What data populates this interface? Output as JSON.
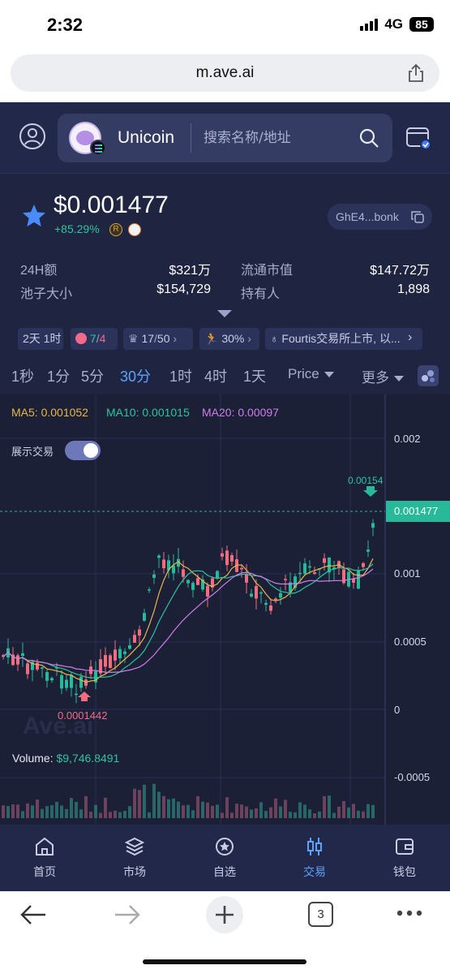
{
  "status": {
    "time": "2:32",
    "network": "4G",
    "battery": "85"
  },
  "browser": {
    "url": "m.ave.ai",
    "tab_count": "3"
  },
  "header": {
    "token_name": "Unicoin",
    "search_placeholder": "搜索名称/地址"
  },
  "price": {
    "value": "$0.001477",
    "change": "+85.29%",
    "address": "GhE4...bonk",
    "stats": [
      {
        "label": "24H额",
        "value": "$321万"
      },
      {
        "label": "流通市值",
        "value": "$147.72万"
      },
      {
        "label": "池子大小",
        "value": "$154,729"
      },
      {
        "label": "持有人",
        "value": "1,898"
      }
    ]
  },
  "chips": {
    "age": "2天 1时",
    "bag_a": "7",
    "bag_b": "4",
    "crown_a": "17",
    "crown_b": "50",
    "runner": "30%",
    "news": "Fourtis交易所上市, 以..."
  },
  "timeframes": [
    {
      "label": "1秒",
      "active": false
    },
    {
      "label": "1分",
      "active": false
    },
    {
      "label": "5分",
      "active": false
    },
    {
      "label": "30分",
      "active": true
    },
    {
      "label": "1时",
      "active": false
    },
    {
      "label": "4时",
      "active": false
    },
    {
      "label": "1天",
      "active": false
    }
  ],
  "dropdowns": {
    "price_mode": "Price",
    "more": "更多"
  },
  "chart": {
    "ma5": "MA5: 0.001052",
    "ma10": "MA10: 0.001015",
    "ma20": "MA20: 0.00097",
    "show_trades": "展示交易",
    "y_ticks": [
      "0.002",
      "0.001",
      "0.0005",
      "0",
      "-0.0005"
    ],
    "last_price": "0.001477",
    "high_marker": "0.00154",
    "low_marker": "0.0001442",
    "watermark": "Ave.ai",
    "volume_label": "Volume:",
    "volume_value": "$9,746.8491"
  },
  "colors": {
    "up": "#27b99a",
    "down": "#ee6e80",
    "ma5": "#e8b74a",
    "ma10": "#2ec4a0",
    "ma20": "#cf7ee8",
    "accent": "#5ea2ff"
  },
  "nav": [
    {
      "label": "首页",
      "icon": "home-icon"
    },
    {
      "label": "市场",
      "icon": "layers-icon"
    },
    {
      "label": "自选",
      "icon": "star-badge-icon"
    },
    {
      "label": "交易",
      "icon": "candles-icon"
    },
    {
      "label": "钱包",
      "icon": "wallet-icon"
    }
  ]
}
